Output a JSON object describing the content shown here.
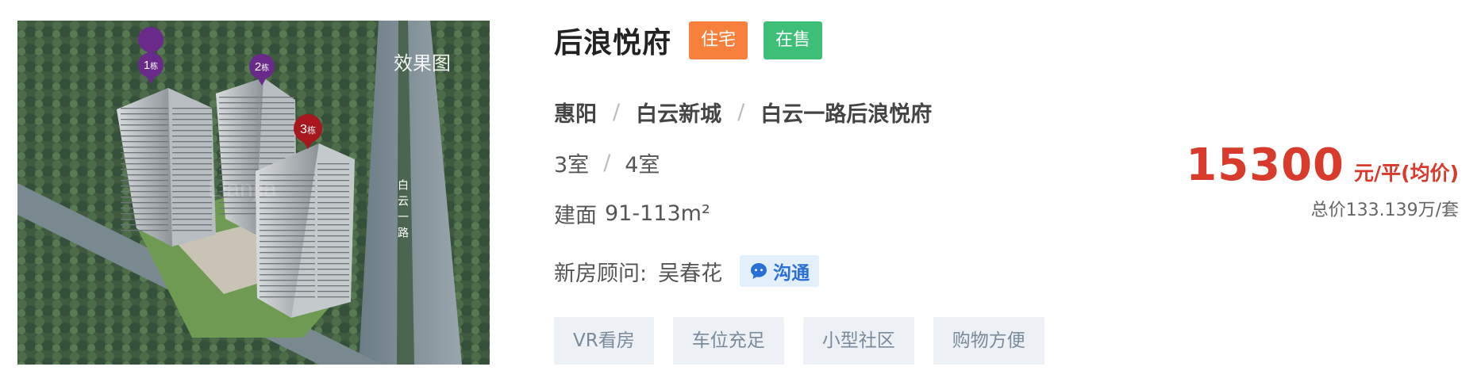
{
  "image": {
    "watermark": "效果图",
    "road_label": "白云一路",
    "faint_watermark": "Lianjia",
    "markers": [
      {
        "label": "1",
        "suffix": "栋",
        "color": "#6a2a8a"
      },
      {
        "label": "2",
        "suffix": "栋",
        "color": "#6a2a8a"
      },
      {
        "label": "3",
        "suffix": "栋",
        "color": "#a8161e"
      }
    ]
  },
  "listing": {
    "title": "后浪悦府",
    "type_badge": "住宅",
    "status_badge": "在售",
    "location": {
      "district": "惠阳",
      "area": "白云新城",
      "address": "白云一路后浪悦府"
    },
    "rooms": [
      "3室",
      "4室"
    ],
    "area_label": "建面",
    "area_range": "91-113",
    "area_unit": "m²",
    "advisor_label": "新房顾问:",
    "advisor_name": "吴春花",
    "chat_label": "沟通",
    "tags": [
      "VR看房",
      "车位充足",
      "小型社区",
      "购物方便"
    ],
    "price": {
      "value": "15300",
      "unit": "元/平(均价)",
      "total": "总价133.139万/套"
    }
  },
  "colors": {
    "type_badge": "#f7803d",
    "status_badge": "#3ebf77",
    "price": "#d83a2c",
    "chat": "#2a6fd6"
  }
}
